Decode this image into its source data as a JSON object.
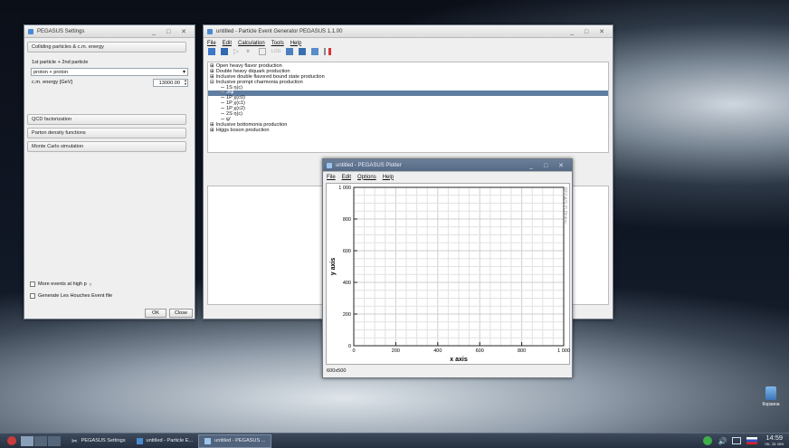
{
  "settings": {
    "title": "PEGASUS Settings",
    "section_colliding": "Colliding particles & c.m. energy",
    "particles_label": "1st particle + 2nd particle",
    "particles_value": "proton + proton",
    "energy_label": "c.m. energy [GeV]",
    "energy_value": "13000.00",
    "section_qcd": "QCD factorization",
    "section_pdf": "Parton density functions",
    "section_mc": "Monte Carlo simulation",
    "check_high_pt": "More events at high p",
    "check_high_pt_sub": "T",
    "check_lhe": "Generate Les Houches Event file",
    "ok_label": "OK",
    "close_label": "Close"
  },
  "main": {
    "title": "untitled - Particle Event Generator PEGASUS 1.1.00",
    "menu": [
      "File",
      "Edit",
      "Calculation",
      "Tools",
      "Help"
    ],
    "tree": [
      {
        "marker": "⊞",
        "label": "Open heavy flavor production",
        "indent": 0
      },
      {
        "marker": "⊞",
        "label": "Double heavy diquark production",
        "indent": 0
      },
      {
        "marker": "⊞",
        "label": "Inclusive double flavored bound state production",
        "indent": 0
      },
      {
        "marker": "⊟",
        "label": "Inclusive prompt charmonia production",
        "indent": 0
      },
      {
        "marker": "",
        "label": "1S η(c)",
        "indent": 1
      },
      {
        "marker": "",
        "label": "J/ψ",
        "indent": 1,
        "selected": true
      },
      {
        "marker": "",
        "label": "1P χ(c0)",
        "indent": 1
      },
      {
        "marker": "",
        "label": "1P χ(c1)",
        "indent": 1
      },
      {
        "marker": "",
        "label": "1P χ(c2)",
        "indent": 1
      },
      {
        "marker": "",
        "label": "2S η(c)",
        "indent": 1
      },
      {
        "marker": "",
        "label": "ψ'",
        "indent": 1
      },
      {
        "marker": "⊞",
        "label": "Inclusive bottomonia production",
        "indent": 0
      },
      {
        "marker": "⊞",
        "label": "Higgs boson production",
        "indent": 0
      }
    ]
  },
  "plotter": {
    "title": "untitled - PEGASUS Plotter",
    "menu": [
      "File",
      "Edit",
      "Options",
      "Help"
    ],
    "watermark": "PEGASUS Plotter",
    "status": "600x500"
  },
  "chart_data": {
    "type": "scatter",
    "xlabel": "x axis",
    "ylabel": "y axis",
    "xlim": [
      0,
      1000
    ],
    "ylim": [
      0,
      1000
    ],
    "x_ticks": [
      "0",
      "200",
      "400",
      "600",
      "800",
      "1 000"
    ],
    "y_ticks": [
      "0",
      "200",
      "400",
      "600",
      "800",
      "1 000"
    ],
    "grid": true,
    "series": []
  },
  "taskbar": {
    "items": [
      "PEGASUS Settings",
      "untitled - Particle E...",
      "untitled - PEGASUS ..."
    ],
    "time": "14:59",
    "date": "пн, 11 сен"
  },
  "desktop": {
    "trash_label": "Корзина"
  },
  "colors": {
    "selection": "#5e7da0",
    "titlebar_active": "#dcdcdc",
    "taskbar": "#263041"
  }
}
